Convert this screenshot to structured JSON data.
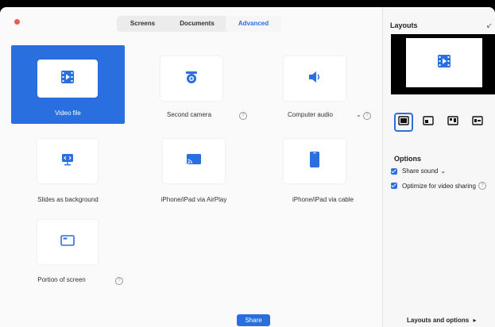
{
  "tabs": [
    {
      "label": "Screens"
    },
    {
      "label": "Documents"
    },
    {
      "label": "Advanced"
    }
  ],
  "tiles": [
    {
      "label": "Video file",
      "icon": "film-icon"
    },
    {
      "label": "Second camera",
      "icon": "webcam-icon"
    },
    {
      "label": "Computer audio",
      "icon": "speaker-icon"
    },
    {
      "label": "Slides as background",
      "icon": "slides-icon"
    },
    {
      "label": "iPhone/iPad via AirPlay",
      "icon": "airplay-icon"
    },
    {
      "label": "iPhone/iPad via cable",
      "icon": "phone-icon"
    },
    {
      "label": "Portion of screen",
      "icon": "window-icon"
    }
  ],
  "share_button": "Share",
  "panel": {
    "title": "Layouts",
    "collapse_icon": "collapse-arrow-icon",
    "options_title": "Options",
    "options": [
      {
        "label": "Share sound",
        "checked": true
      },
      {
        "label": "Optimize for video sharing",
        "checked": true
      }
    ],
    "footer": "Layouts and options"
  },
  "colors": {
    "accent": "#2a6fe0",
    "close": "#ee5b55"
  }
}
